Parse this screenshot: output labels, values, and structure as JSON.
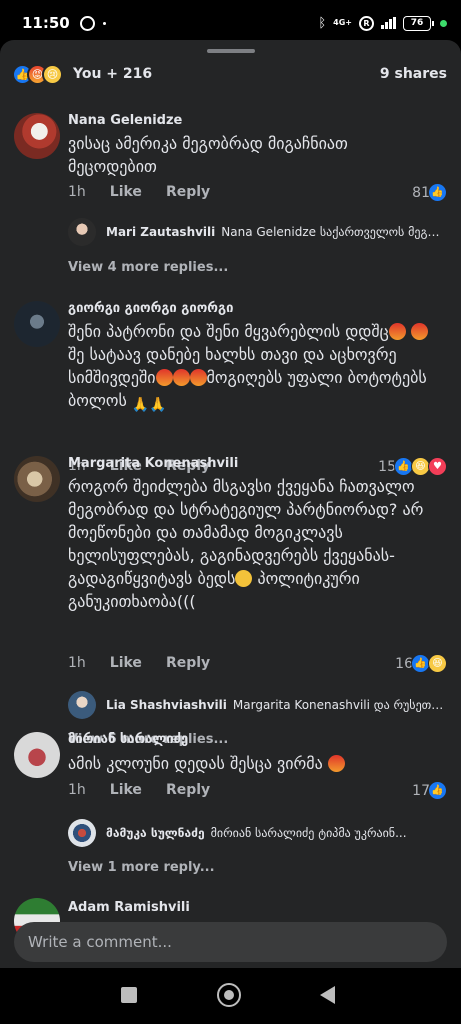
{
  "status_bar": {
    "time": "11:50",
    "network": "4G+",
    "r_badge": "R",
    "battery": "76"
  },
  "reactions": {
    "summary": "You + 216",
    "shares": "9 shares",
    "icons": [
      "like-icon",
      "angry-icon",
      "sad-icon"
    ]
  },
  "comments": [
    {
      "author": "Nana Gelenidze",
      "text": "ვისაც ამერიკა მეგობრად მიგაჩნიათ მეცოდებით",
      "time": "1h",
      "like_label": "Like",
      "reply_label": "Reply",
      "reaction_count": "81",
      "reaction_icons": [
        "like-icon"
      ],
      "reply_preview": {
        "author": "Mari Zautashvili",
        "snippet": "Nana Gelenidze საქართველოს მეგობა..."
      },
      "view_more": "View 4 more replies..."
    },
    {
      "author": "გიორგი გიორგი გიორგი",
      "text_parts": [
        "შენი პატრონი და შენი მყვარებლის დდშც",
        "შე სატაავ დანებე ხალხს თავი და აცხოვრე სიმშივდეში",
        "მოგიღებს უფალი ბოტოტებს ბოლოს "
      ],
      "time": "1h",
      "like_label": "Like",
      "reply_label": "Reply",
      "reaction_count": "15",
      "reaction_icons": [
        "like-icon",
        "haha-icon",
        "love-icon"
      ]
    },
    {
      "author": "Margarita Konenashvili",
      "text": "როგორ შეიძლება მსგავსი ქვეყანა ჩათვალო მეგობრად და სტრატეგიულ პარტნიორად? არ მოეწონები და თამამად მოგიკლავს ხელისუფლებას, გაგინადვერებს ქვეყანას-გადაგიწყვიტავს ბედს",
      "text_tail": "პოლიტიკური განუკითხაობა(((",
      "time": "1h",
      "like_label": "Like",
      "reply_label": "Reply",
      "reaction_count": "16",
      "reaction_icons": [
        "like-icon",
        "haha-icon"
      ],
      "reply_preview": {
        "author": "Lia Shashviashvili",
        "snippet": "Margarita Konenashvili და რუსეთი რა..."
      },
      "view_more": "View 6 more replies..."
    },
    {
      "author": "მირიან სარალიძე",
      "text": "ამის კლოუნი დედას შესცა ვირმა ",
      "time": "1h",
      "like_label": "Like",
      "reply_label": "Reply",
      "reaction_count": "17",
      "reaction_icons": [
        "like-icon"
      ],
      "reply_preview": {
        "author": "მამუკა სულნაძე",
        "snippet": "მირიან სარალიძე ტიპმა უკრაინ..."
      },
      "view_more": "View 1 more reply..."
    },
    {
      "author": "Adam Ramishvili"
    }
  ],
  "composer": {
    "placeholder": "Write a comment..."
  },
  "colors": {
    "background": "#242526",
    "accent": "#1877f2",
    "text": "#e4e6eb",
    "muted": "#b0b3b8"
  }
}
